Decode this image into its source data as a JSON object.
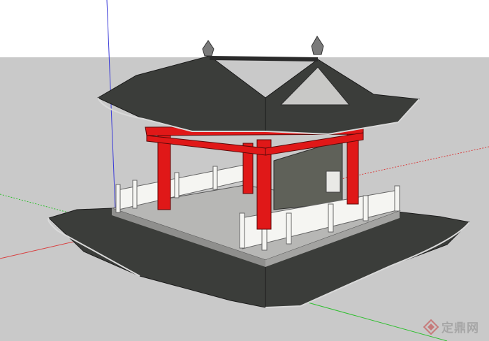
{
  "viewport": {
    "sky_color": "#ffffff",
    "ground_color": "#c9c9c9"
  },
  "model": {
    "subject": "pavilion",
    "colors": {
      "roof": "#3b3d3a",
      "roof_edge": "#d9d9d9",
      "columns": "#e01818",
      "wall": "#5f6159",
      "platform": "#b7b7b5",
      "railing": "#f5f5f2"
    }
  },
  "axes": {
    "blue": "#3a3ad8",
    "red": "#d84040",
    "green": "#2fbf2f"
  },
  "watermark": {
    "text": "定鼎网",
    "logo_icon": "diamond-logo-icon"
  }
}
